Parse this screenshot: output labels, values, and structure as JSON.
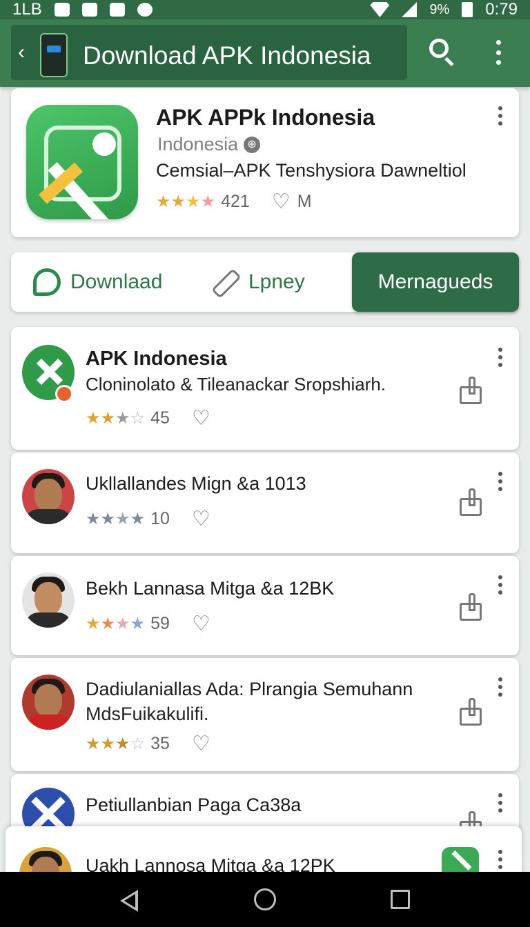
{
  "status_bar": {
    "left_text": "1LB",
    "battery_percent": "9%",
    "time": "0:79",
    "icons": [
      "sd-card-icon",
      "image-icon",
      "notification-icon",
      "chevron-down-circle-icon",
      "wifi-icon",
      "signal-icon",
      "battery-icon"
    ]
  },
  "app_bar": {
    "title": "Download APK Indonesia",
    "icons": [
      "back-arrow-icon",
      "phone-icon",
      "search-icon",
      "more-vert-icon"
    ]
  },
  "header_card": {
    "title": "APK APPk Indonesia",
    "subtitle": "Indonesia",
    "description": "Cemsial–APK Tenshysiora Dawneltiol",
    "rating_count": "421",
    "meta": "M",
    "stars": 4
  },
  "tabs": [
    {
      "label": "Downlaad",
      "icon": "chat-icon",
      "active": false
    },
    {
      "label": "Lpney",
      "icon": "pen-icon",
      "active": false
    },
    {
      "label": "Mernagueds",
      "icon": "",
      "active": true
    }
  ],
  "list": {
    "items": [
      {
        "title": "APK Indonesia",
        "subtitle": "Cloninolato & Tileanackar Sropshiarh.",
        "rating": "45",
        "stars": 2.5
      },
      {
        "title": "Ukllallandes Mign &a 1013",
        "subtitle": "",
        "rating": "10",
        "stars": 4
      },
      {
        "title": "Bekh Lannasa Mitga &a 12BK",
        "subtitle": "",
        "rating": "59",
        "stars": 4
      },
      {
        "title": "Dadiulaniallas Ada: Plrangia Semuhann",
        "subtitle": "MdsFuikakulifi.",
        "rating": "35",
        "stars": 3.5
      },
      {
        "title": "Petiullanbian Paga Ca38a",
        "subtitle": "",
        "rating": "",
        "stars": 0
      },
      {
        "title": "Uakh Lannosa Mitga &a 12PK",
        "subtitle": "",
        "rating": "",
        "stars": 0
      }
    ]
  },
  "colors": {
    "app_bar": "#3b7e52",
    "status_bar": "#2f6a45",
    "accent": "#2a7a45",
    "active_tab": "#2e6b47",
    "star_gold": "#e0a22d"
  }
}
